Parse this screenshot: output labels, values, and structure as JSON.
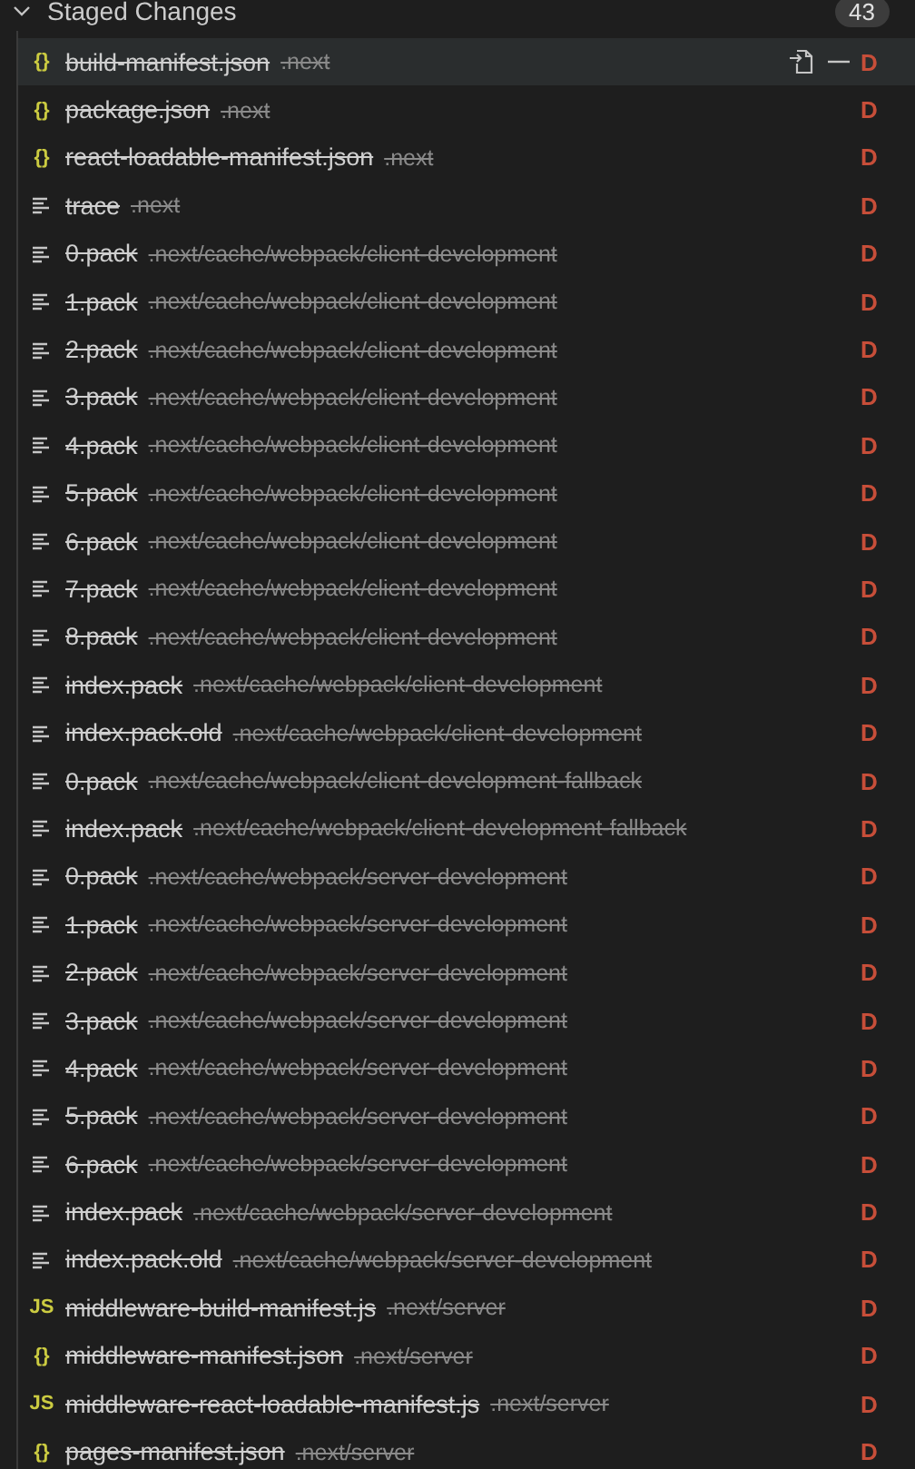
{
  "section": {
    "title": "Staged Changes",
    "expanded": true,
    "count": "43"
  },
  "files": [
    {
      "kind": "json",
      "glyph": "{}",
      "name": "build-manifest.json",
      "path": ".next",
      "status": "D",
      "selected": true
    },
    {
      "kind": "json",
      "glyph": "{}",
      "name": "package.json",
      "path": ".next",
      "status": "D",
      "selected": false
    },
    {
      "kind": "json",
      "glyph": "{}",
      "name": "react-loadable-manifest.json",
      "path": ".next",
      "status": "D",
      "selected": false
    },
    {
      "kind": "text",
      "name": "trace",
      "path": ".next",
      "status": "D",
      "selected": false
    },
    {
      "kind": "text",
      "name": "0.pack",
      "path": ".next/cache/webpack/client-development",
      "status": "D",
      "selected": false
    },
    {
      "kind": "text",
      "name": "1.pack",
      "path": ".next/cache/webpack/client-development",
      "status": "D",
      "selected": false
    },
    {
      "kind": "text",
      "name": "2.pack",
      "path": ".next/cache/webpack/client-development",
      "status": "D",
      "selected": false
    },
    {
      "kind": "text",
      "name": "3.pack",
      "path": ".next/cache/webpack/client-development",
      "status": "D",
      "selected": false
    },
    {
      "kind": "text",
      "name": "4.pack",
      "path": ".next/cache/webpack/client-development",
      "status": "D",
      "selected": false
    },
    {
      "kind": "text",
      "name": "5.pack",
      "path": ".next/cache/webpack/client-development",
      "status": "D",
      "selected": false
    },
    {
      "kind": "text",
      "name": "6.pack",
      "path": ".next/cache/webpack/client-development",
      "status": "D",
      "selected": false
    },
    {
      "kind": "text",
      "name": "7.pack",
      "path": ".next/cache/webpack/client-development",
      "status": "D",
      "selected": false
    },
    {
      "kind": "text",
      "name": "8.pack",
      "path": ".next/cache/webpack/client-development",
      "status": "D",
      "selected": false
    },
    {
      "kind": "text",
      "name": "index.pack",
      "path": ".next/cache/webpack/client-development",
      "status": "D",
      "selected": false
    },
    {
      "kind": "text",
      "name": "index.pack.old",
      "path": ".next/cache/webpack/client-development",
      "status": "D",
      "selected": false
    },
    {
      "kind": "text",
      "name": "0.pack",
      "path": ".next/cache/webpack/client-development-fallback",
      "status": "D",
      "selected": false
    },
    {
      "kind": "text",
      "name": "index.pack",
      "path": ".next/cache/webpack/client-development-fallback",
      "status": "D",
      "selected": false
    },
    {
      "kind": "text",
      "name": "0.pack",
      "path": ".next/cache/webpack/server-development",
      "status": "D",
      "selected": false
    },
    {
      "kind": "text",
      "name": "1.pack",
      "path": ".next/cache/webpack/server-development",
      "status": "D",
      "selected": false
    },
    {
      "kind": "text",
      "name": "2.pack",
      "path": ".next/cache/webpack/server-development",
      "status": "D",
      "selected": false
    },
    {
      "kind": "text",
      "name": "3.pack",
      "path": ".next/cache/webpack/server-development",
      "status": "D",
      "selected": false
    },
    {
      "kind": "text",
      "name": "4.pack",
      "path": ".next/cache/webpack/server-development",
      "status": "D",
      "selected": false
    },
    {
      "kind": "text",
      "name": "5.pack",
      "path": ".next/cache/webpack/server-development",
      "status": "D",
      "selected": false
    },
    {
      "kind": "text",
      "name": "6.pack",
      "path": ".next/cache/webpack/server-development",
      "status": "D",
      "selected": false
    },
    {
      "kind": "text",
      "name": "index.pack",
      "path": ".next/cache/webpack/server-development",
      "status": "D",
      "selected": false
    },
    {
      "kind": "text",
      "name": "index.pack.old",
      "path": ".next/cache/webpack/server-development",
      "status": "D",
      "selected": false
    },
    {
      "kind": "js",
      "glyph": "JS",
      "name": "middleware-build-manifest.js",
      "path": ".next/server",
      "status": "D",
      "selected": false
    },
    {
      "kind": "json",
      "glyph": "{}",
      "name": "middleware-manifest.json",
      "path": ".next/server",
      "status": "D",
      "selected": false
    },
    {
      "kind": "js",
      "glyph": "JS",
      "name": "middleware-react-loadable-manifest.js",
      "path": ".next/server",
      "status": "D",
      "selected": false
    },
    {
      "kind": "json",
      "glyph": "{}",
      "name": "pages-manifest.json",
      "path": ".next/server",
      "status": "D",
      "selected": false
    }
  ]
}
